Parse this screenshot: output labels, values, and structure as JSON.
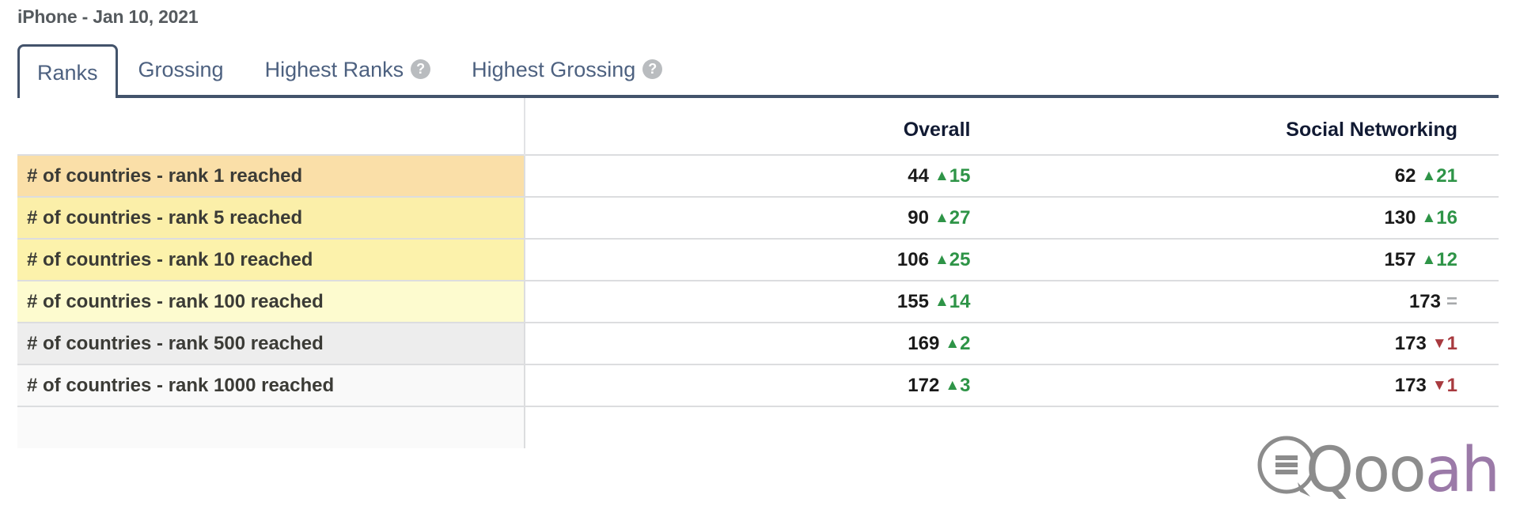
{
  "header": {
    "title": "iPhone - Jan 10, 2021"
  },
  "tabs": [
    {
      "label": "Ranks",
      "active": true,
      "has_help_icon": false,
      "icon": ""
    },
    {
      "label": "Grossing",
      "active": false,
      "has_help_icon": false,
      "icon": ""
    },
    {
      "label": "Highest Ranks",
      "active": false,
      "has_help_icon": true,
      "icon": "help-circle-icon"
    },
    {
      "label": "Highest Grossing",
      "active": false,
      "has_help_icon": true,
      "icon": "help-circle-icon"
    }
  ],
  "table": {
    "columns": [
      "",
      "Overall",
      "Social Networking"
    ],
    "rows": [
      {
        "label": "# of countries - rank 1 reached",
        "row_color": "#fadfa8",
        "overall": {
          "value": "44",
          "delta": "15",
          "direction": "up"
        },
        "social": {
          "value": "62",
          "delta": "21",
          "direction": "up"
        }
      },
      {
        "label": "# of countries - rank 5 reached",
        "row_color": "#fbefa9",
        "overall": {
          "value": "90",
          "delta": "27",
          "direction": "up"
        },
        "social": {
          "value": "130",
          "delta": "16",
          "direction": "up"
        }
      },
      {
        "label": "# of countries - rank 10 reached",
        "row_color": "#fcf2ab",
        "overall": {
          "value": "106",
          "delta": "25",
          "direction": "up"
        },
        "social": {
          "value": "157",
          "delta": "12",
          "direction": "up"
        }
      },
      {
        "label": "# of countries - rank 100 reached",
        "row_color": "#fdfbcf",
        "overall": {
          "value": "155",
          "delta": "14",
          "direction": "up"
        },
        "social": {
          "value": "173",
          "delta": "",
          "direction": "flat"
        }
      },
      {
        "label": "# of countries - rank 500 reached",
        "row_color": "#ededed",
        "overall": {
          "value": "169",
          "delta": "2",
          "direction": "up"
        },
        "social": {
          "value": "173",
          "delta": "1",
          "direction": "down"
        }
      },
      {
        "label": "# of countries - rank 1000 reached",
        "row_color": "#f9f9f9",
        "overall": {
          "value": "172",
          "delta": "3",
          "direction": "up"
        },
        "social": {
          "value": "173",
          "delta": "1",
          "direction": "down"
        }
      },
      {
        "label": "",
        "row_color": "#fafafa",
        "overall": {
          "value": "",
          "delta": "",
          "direction": "none"
        },
        "social": {
          "value": "",
          "delta": "",
          "direction": "none"
        }
      }
    ]
  },
  "watermark": {
    "text_gray": "Qoo",
    "text_purple": "ah",
    "icon": "qooah-logo-icon"
  },
  "glyphs": {
    "arrow_up": "▲",
    "arrow_down": "▼",
    "flat": "=",
    "help": "?"
  },
  "colors": {
    "tab_active_border": "#43536b",
    "tab_text": "#4d6180",
    "up": "#2e9447",
    "down": "#a83a3f",
    "flat": "#a7a9ab",
    "header_text": "#111a33",
    "title_text": "#555a5e"
  }
}
